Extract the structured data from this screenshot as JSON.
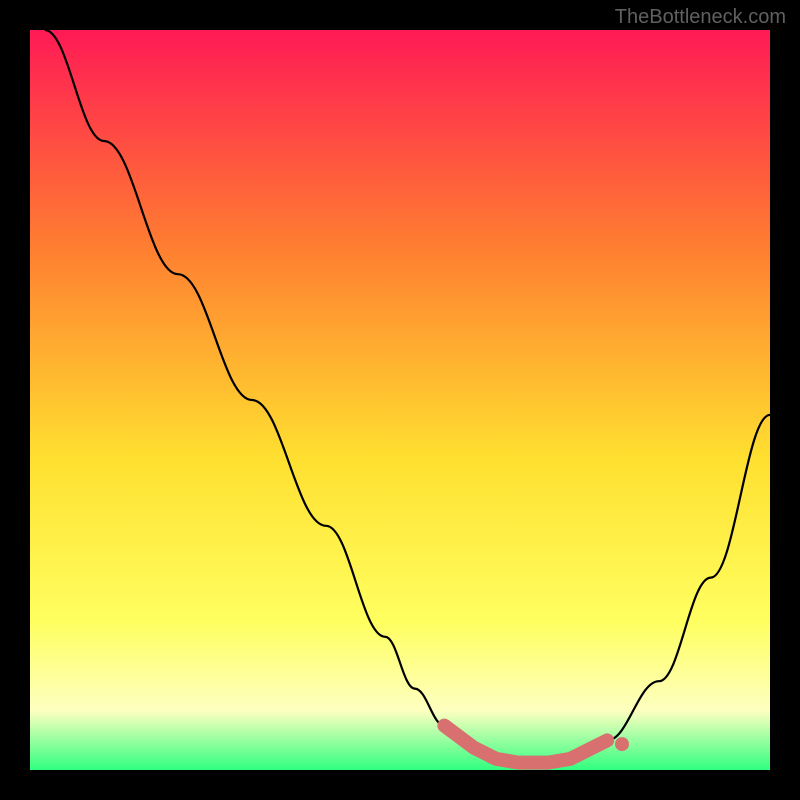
{
  "watermark": "TheBottleneck.com",
  "colors": {
    "background": "#000000",
    "gradient_top": "#ff1a55",
    "gradient_mid_upper": "#ff8030",
    "gradient_mid": "#ffe030",
    "gradient_lower_yellow": "#ffff60",
    "gradient_pale": "#fdffc0",
    "gradient_bottom": "#30ff80",
    "curve": "#000000",
    "marker": "#d87070"
  },
  "chart_data": {
    "type": "line",
    "title": "",
    "xlabel": "",
    "ylabel": "",
    "xlim": [
      0,
      100
    ],
    "ylim": [
      0,
      100
    ],
    "series": [
      {
        "name": "bottleneck-curve",
        "x": [
          2,
          10,
          20,
          30,
          40,
          48,
          52,
          56,
          60,
          63,
          66,
          70,
          73,
          78,
          85,
          92,
          100
        ],
        "y": [
          100,
          85,
          67,
          50,
          33,
          18,
          11,
          6,
          3,
          1.5,
          1,
          1,
          1.5,
          4,
          12,
          26,
          48
        ]
      }
    ],
    "markers": {
      "name": "highlight-range",
      "x_range": [
        56,
        78
      ],
      "y_level": 2
    }
  }
}
